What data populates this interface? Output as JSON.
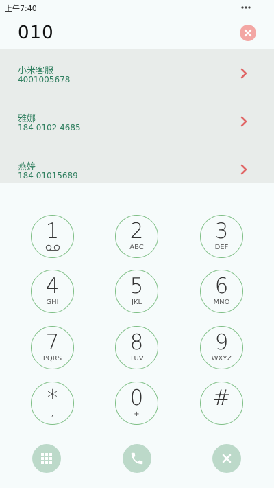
{
  "status_bar": {
    "time": "上午7:40",
    "more_icon": "more-dots-icon"
  },
  "dialer": {
    "input_value": "010",
    "clear_icon": "clear-icon"
  },
  "search_results": [
    {
      "name": "小米客服",
      "number": "4001005678"
    },
    {
      "name": "雅娜",
      "number": "184 0102 4685"
    },
    {
      "name": "燕婷",
      "number": "184 01015689"
    }
  ],
  "keypad": {
    "keys": [
      {
        "digit": "1",
        "letters": "",
        "icon": "voicemail-icon"
      },
      {
        "digit": "2",
        "letters": "ABC"
      },
      {
        "digit": "3",
        "letters": "DEF"
      },
      {
        "digit": "4",
        "letters": "GHI"
      },
      {
        "digit": "5",
        "letters": "JKL"
      },
      {
        "digit": "6",
        "letters": "MNO"
      },
      {
        "digit": "7",
        "letters": "PQRS"
      },
      {
        "digit": "8",
        "letters": "TUV"
      },
      {
        "digit": "9",
        "letters": "WXYZ"
      },
      {
        "digit": "*",
        "letters": ","
      },
      {
        "digit": "0",
        "letters": "+"
      },
      {
        "digit": "#",
        "letters": ""
      }
    ]
  },
  "bottom_actions": {
    "keypad_toggle_icon": "dialpad-grid-icon",
    "call_icon": "phone-icon",
    "delete_icon": "close-icon"
  },
  "colors": {
    "accent_green": "#2f7f5f",
    "key_border": "#7fbf86",
    "action_circle": "#bcd9c9",
    "clear_red": "#f3a7a4",
    "chevron_red": "#e06666",
    "results_bg": "#e8ecea"
  }
}
